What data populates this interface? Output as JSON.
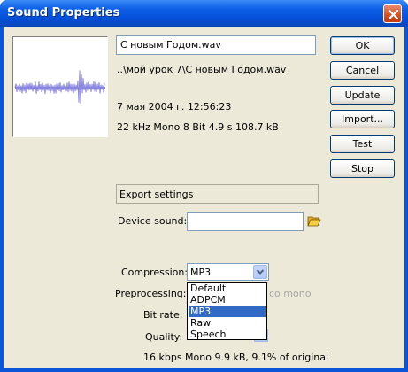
{
  "window": {
    "title": "Sound Properties"
  },
  "sound": {
    "name": "С новым Годом.wav",
    "path": "..\\мой урок 7\\С новым Годом.wav",
    "date": "7 мая 2004 г.  12:56:23",
    "info": "22 kHz Mono 8 Bit 4.9 s 108.7 kB"
  },
  "buttons": {
    "ok": "OK",
    "cancel": "Cancel",
    "update": "Update",
    "import": "Import...",
    "test": "Test",
    "stop": "Stop"
  },
  "export": {
    "heading": "Export settings",
    "device_sound_label": "Device sound:",
    "device_sound_value": "",
    "compression_label": "Compression:",
    "compression_value": "MP3",
    "preprocessing_label": "Preprocessing:",
    "preprocessing_hint": "co mono",
    "bitrate_label": "Bit rate:",
    "quality_label": "Quality:",
    "summary": "16 kbps Mono 9.9 kB, 9.1% of original",
    "options": [
      "Default",
      "ADPCM",
      "MP3",
      "Raw",
      "Speech"
    ],
    "selected_index": 2
  },
  "icons": {
    "close": "close-icon",
    "folder": "folder-icon",
    "dropdown": "chevron-down-icon",
    "waveform": "waveform-icon"
  },
  "colors": {
    "titlebar": "#0a55d8",
    "waveform": "#8a86e0",
    "selection": "#316ac5",
    "close": "#d4501e"
  }
}
